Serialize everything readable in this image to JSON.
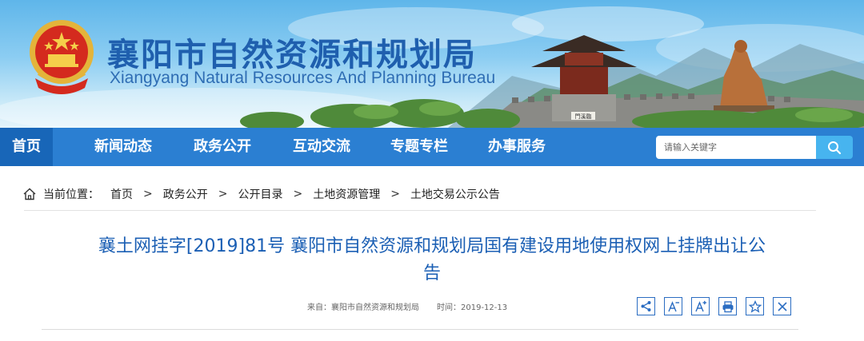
{
  "header": {
    "title": "襄阳市自然资源和规划局",
    "subtitle": "Xiangyang Natural Resources And Planning Bureau",
    "emblem_icon": "national-emblem-icon",
    "gate_sign": "門溪臨"
  },
  "nav": {
    "items": [
      {
        "label": "首页",
        "active": true
      },
      {
        "label": "新闻动态",
        "active": false
      },
      {
        "label": "政务公开",
        "active": false
      },
      {
        "label": "互动交流",
        "active": false
      },
      {
        "label": "专题专栏",
        "active": false
      },
      {
        "label": "办事服务",
        "active": false
      }
    ],
    "search_placeholder": "请输入关键字",
    "search_icon": "search-icon"
  },
  "breadcrumb": {
    "prefix": "当前位置：",
    "items": [
      "首页",
      "政务公开",
      "公开目录",
      "土地资源管理",
      "土地交易公示公告"
    ],
    "separator": ">"
  },
  "article": {
    "title_line1": "襄土网挂字[2019]81号 襄阳市自然资源和规划局国有建设用地使用权网上挂牌出让公",
    "title_line2": "告",
    "source": "来自：襄阳市自然资源和规划局",
    "time": "时间：2019-12-13",
    "tools": [
      "share-icon",
      "font-decrease-icon",
      "font-increase-icon",
      "print-icon",
      "favorite-icon",
      "close-icon"
    ]
  },
  "colors": {
    "nav_bg": "#2b7fd2",
    "nav_active": "#1866b8",
    "title_blue": "#1b5fb4",
    "search_button": "#47b4ef"
  }
}
